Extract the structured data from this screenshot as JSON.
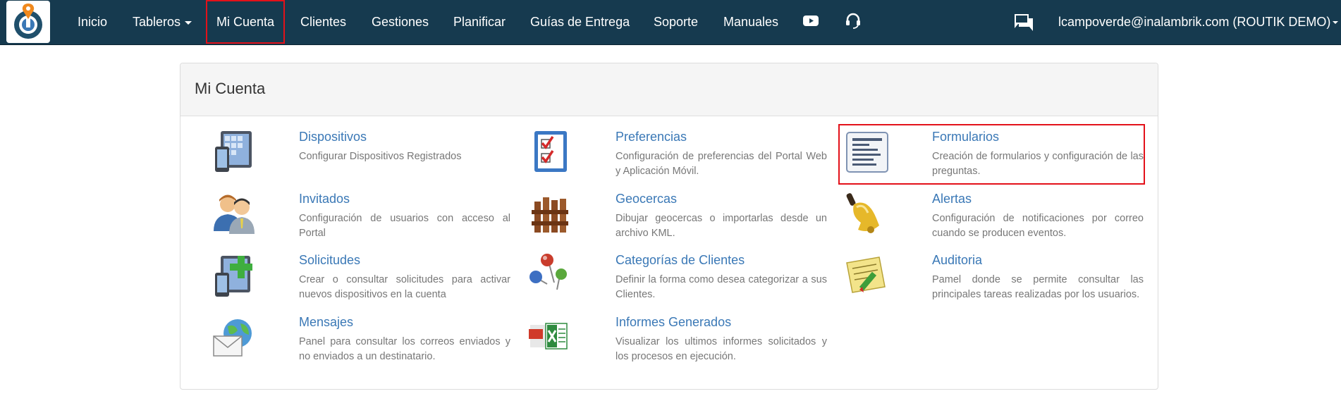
{
  "navbar": {
    "items": [
      {
        "label": "Inicio"
      },
      {
        "label": "Tableros"
      },
      {
        "label": "Mi Cuenta"
      },
      {
        "label": "Clientes"
      },
      {
        "label": "Gestiones"
      },
      {
        "label": "Planificar"
      },
      {
        "label": "Guías de Entrega"
      },
      {
        "label": "Soporte"
      },
      {
        "label": "Manuales"
      }
    ],
    "active": "Mi Cuenta",
    "icons": [
      "youtube-icon",
      "headset-icon",
      "chat-icon"
    ],
    "user_label": "lcampoverde@inalambrik.com (ROUTIK DEMO)"
  },
  "panel": {
    "title": "Mi Cuenta",
    "cards": [
      {
        "title": "Dispositivos",
        "desc": "Configurar Dispositivos Registrados",
        "icon": "devices-icon"
      },
      {
        "title": "Preferencias",
        "desc": "Configuración de preferencias del Portal Web y Aplicación Móvil.",
        "icon": "checklist-icon"
      },
      {
        "title": "Formularios",
        "desc": "Creación de formularios y configuración de las preguntas.",
        "icon": "form-icon"
      },
      {
        "title": "Invitados",
        "desc": "Configuración de usuarios con acceso al Portal",
        "icon": "users-icon"
      },
      {
        "title": "Geocercas",
        "desc": "Dibujar geocercas o importarlas desde un archivo KML.",
        "icon": "fence-icon"
      },
      {
        "title": "Alertas",
        "desc": "Configuración de notificaciones por correo cuando se producen eventos.",
        "icon": "bell-icon"
      },
      {
        "title": "Solicitudes",
        "desc": "Crear o consultar solicitudes para activar nuevos dispositivos en la cuenta",
        "icon": "add-device-icon"
      },
      {
        "title": "Categorías de Clientes",
        "desc": "Definir la forma como desea categorizar a sus Clientes.",
        "icon": "pins-icon"
      },
      {
        "title": "Auditoria",
        "desc": "Pamel donde se permite consultar las principales tareas realizadas por los usuarios.",
        "icon": "audit-icon"
      },
      {
        "title": "Mensajes",
        "desc": "Panel para consultar los correos enviados y no enviados a un destinatario.",
        "icon": "mail-globe-icon"
      },
      {
        "title": "Informes Generados",
        "desc": "Visualizar los ultimos informes solicitados y los procesos en ejecución.",
        "icon": "reports-icon"
      }
    ]
  },
  "colors": {
    "navbar": "#163a4f",
    "link": "#3a78b6",
    "highlight": "#e3111a"
  }
}
